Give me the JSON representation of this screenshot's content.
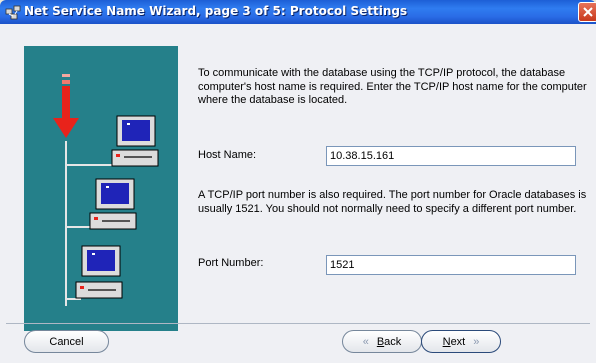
{
  "window": {
    "title": "Net Service Name Wizard, page 3 of 5: Protocol Settings",
    "title_icon": "wizard-app-icon",
    "close_icon": "close-x-icon"
  },
  "intro_text": "To communicate with the database using the TCP/IP protocol, the database computer's host name is required.  Enter the TCP/IP host name for the computer where the database is located.",
  "host": {
    "label": "Host Name:",
    "value": "10.38.15.161"
  },
  "port_text": "A TCP/IP port number is also required.  The port number for Oracle databases is usually 1521.  You should not normally need to specify a different port number.",
  "port": {
    "label": "Port Number:",
    "value": "1521"
  },
  "buttons": {
    "cancel": "Cancel",
    "back_mnemonic": "B",
    "back_rest": "ack",
    "next_mnemonic": "N",
    "next_rest": "ext"
  },
  "illustration": {
    "accent_arrow_color": "#e8231b",
    "background_color": "#25808a"
  }
}
